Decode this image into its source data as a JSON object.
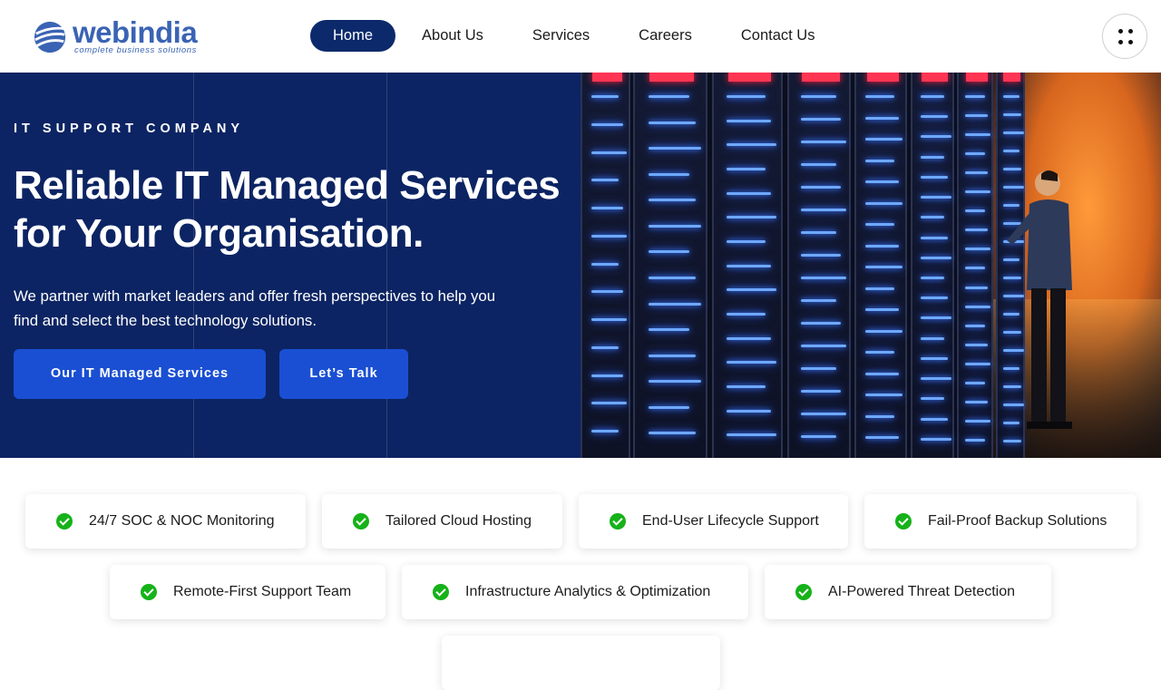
{
  "brand": {
    "name": "webindia",
    "tagline": "complete business solutions",
    "color": "#3a63b4"
  },
  "nav": {
    "items": [
      {
        "label": "Home",
        "active": true
      },
      {
        "label": "About Us",
        "active": false
      },
      {
        "label": "Services",
        "active": false
      },
      {
        "label": "Careers",
        "active": false
      },
      {
        "label": "Contact Us",
        "active": false
      }
    ],
    "menu_icon": "grid-dots-icon"
  },
  "hero": {
    "kicker": "IT SUPPORT COMPANY",
    "title": "Reliable IT Managed Services for Your Organisation.",
    "description": "We partner with market leaders and offer fresh perspectives to help you find and select the best technology solutions.",
    "primary_button": "Our IT Managed Services",
    "secondary_button": "Let’s Talk",
    "image_subject": "data-center-server-racks-photo",
    "colors": {
      "navy": "#0c2463",
      "button": "#1a4fd3"
    }
  },
  "features": [
    "24/7 SOC & NOC Monitoring",
    "Tailored Cloud Hosting",
    "End-User Lifecycle Support",
    "Fail-Proof Backup Solutions",
    "Remote-First Support Team",
    "Infrastructure Analytics & Optimization",
    "AI-Powered Threat Detection"
  ],
  "feature_icon": "check-circle-icon",
  "check_color": "#16b219"
}
